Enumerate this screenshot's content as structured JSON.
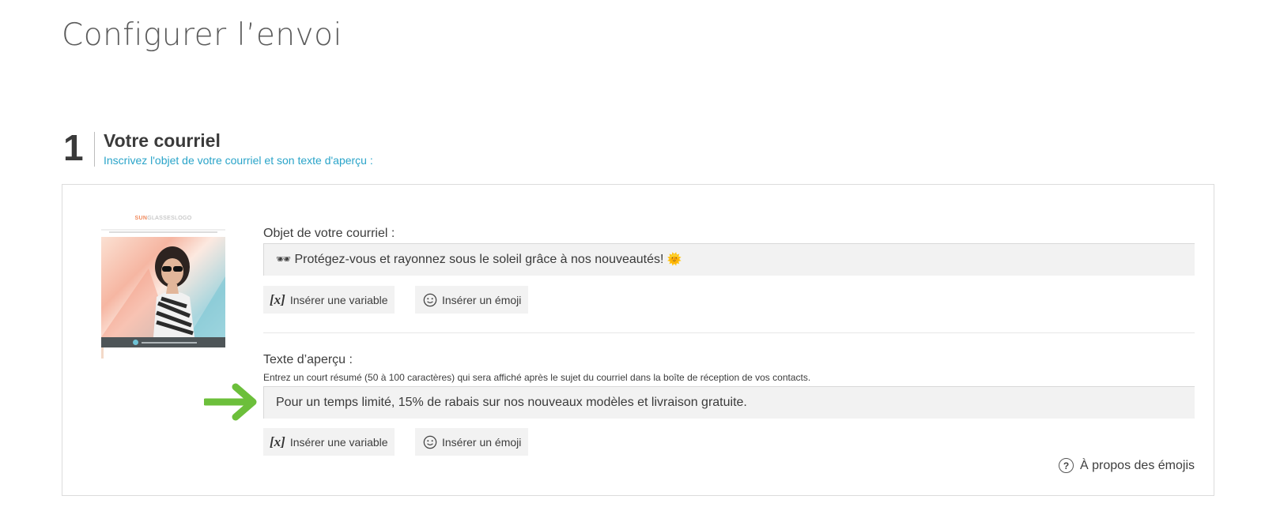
{
  "page": {
    "title": "Configurer l’envoi"
  },
  "step": {
    "number": "1",
    "title": "Votre courriel",
    "subtitle": "Inscrivez l'objet de votre courriel et son texte d'aperçu :"
  },
  "thumbnail": {
    "logo_accent": "SUN",
    "logo_main": "GLASSES",
    "logo_suffix": "LOGO"
  },
  "subject": {
    "label": "Objet de votre courriel :",
    "leading_emoji": "🕶",
    "value": "Protégez-vous et rayonnez sous le soleil grâce à nos nouveautés!",
    "trailing_emoji": "🌞"
  },
  "preview": {
    "label": "Texte d’aperçu :",
    "hint": "Entrez un court résumé (50 à 100 caractères) qui sera affiché après le sujet du courriel dans la boîte de réception de vos contacts.",
    "value": "Pour un temps limité, 15% de rabais sur nos nouveaux modèles et livraison gratuite."
  },
  "buttons": {
    "variable_icon": "[x]",
    "insert_variable": "Insérer une variable",
    "insert_emoji": "Insérer un émoji"
  },
  "about_emojis": {
    "icon": "?",
    "label": "À propos des émojis"
  },
  "colors": {
    "accent_blue": "#2aa4c9",
    "arrow_green": "#6cbf3b",
    "field_bg": "#f2f2f2"
  }
}
